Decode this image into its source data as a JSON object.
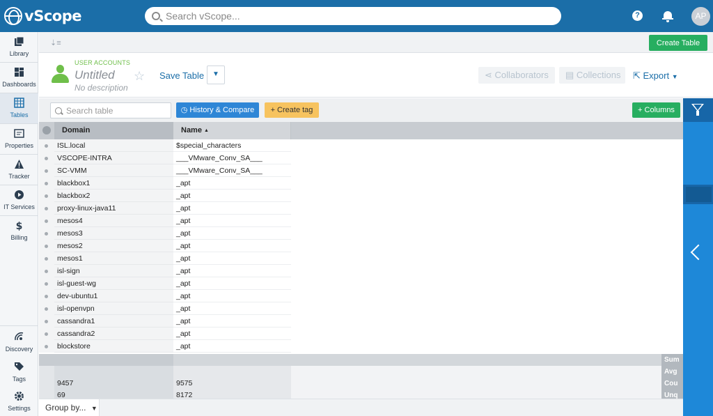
{
  "app": {
    "name": "vScope"
  },
  "topbar": {
    "search_placeholder": "Search vScope...",
    "help_glyph": "?",
    "avatar_initials": "AP"
  },
  "nav": {
    "top": [
      {
        "label": "Library",
        "icon": "library-icon"
      },
      {
        "label": "Dashboards",
        "icon": "dashboards-icon"
      },
      {
        "label": "Tables",
        "icon": "tables-icon",
        "active": true
      },
      {
        "label": "Properties",
        "icon": "properties-icon"
      },
      {
        "label": "Tracker",
        "icon": "tracker-icon"
      },
      {
        "label": "IT Services",
        "icon": "it-services-icon"
      },
      {
        "label": "Billing",
        "icon": "billing-icon"
      }
    ],
    "bottom": [
      {
        "label": "Discovery",
        "icon": "discovery-icon"
      },
      {
        "label": "Tags",
        "icon": "tags-icon"
      },
      {
        "label": "Settings",
        "icon": "settings-icon"
      }
    ]
  },
  "toolbar": {
    "create_table_label": "Create Table"
  },
  "header": {
    "type_label": "USER ACCOUNTS",
    "title": "Untitled",
    "description": "No description",
    "save_label": "Save Table",
    "collaborators_label": "Collaborators",
    "collections_label": "Collections",
    "export_label": "Export"
  },
  "table_toolbar": {
    "search_placeholder": "Search table",
    "history_label": "History & Compare",
    "create_tag_label": "Create tag",
    "columns_label": "Columns"
  },
  "table": {
    "columns": [
      "Domain",
      "Name"
    ],
    "sort_indicator": "▲",
    "rows": [
      {
        "domain": "ISL.local",
        "name": "$special_characters"
      },
      {
        "domain": "VSCOPE-INTRA",
        "name": "___VMware_Conv_SA___"
      },
      {
        "domain": "SC-VMM",
        "name": "___VMware_Conv_SA___"
      },
      {
        "domain": "blackbox1",
        "name": "_apt"
      },
      {
        "domain": "blackbox2",
        "name": "_apt"
      },
      {
        "domain": "proxy-linux-java11",
        "name": "_apt"
      },
      {
        "domain": "mesos4",
        "name": "_apt"
      },
      {
        "domain": "mesos3",
        "name": "_apt"
      },
      {
        "domain": "mesos2",
        "name": "_apt"
      },
      {
        "domain": "mesos1",
        "name": "_apt"
      },
      {
        "domain": "isl-sign",
        "name": "_apt"
      },
      {
        "domain": "isl-guest-wg",
        "name": "_apt"
      },
      {
        "domain": "dev-ubuntu1",
        "name": "_apt"
      },
      {
        "domain": "isl-openvpn",
        "name": "_apt"
      },
      {
        "domain": "cassandra1",
        "name": "_apt"
      },
      {
        "domain": "cassandra2",
        "name": "_apt"
      },
      {
        "domain": "blockstore",
        "name": "_apt"
      }
    ],
    "aggregates": [
      {
        "label": "Sum",
        "domain": "",
        "name": ""
      },
      {
        "label": "Avg",
        "domain": "",
        "name": ""
      },
      {
        "label": "Cou",
        "domain": "9457",
        "name": "9575"
      },
      {
        "label": "Unq",
        "domain": "69",
        "name": "8172"
      }
    ]
  },
  "footer": {
    "group_by_label": "Group by..."
  },
  "colors": {
    "brand": "#1b6ea8",
    "green": "#27ae60",
    "blue_button": "#2e86d6",
    "yellow_button": "#f7c35f",
    "user_green": "#6fbf4a"
  }
}
